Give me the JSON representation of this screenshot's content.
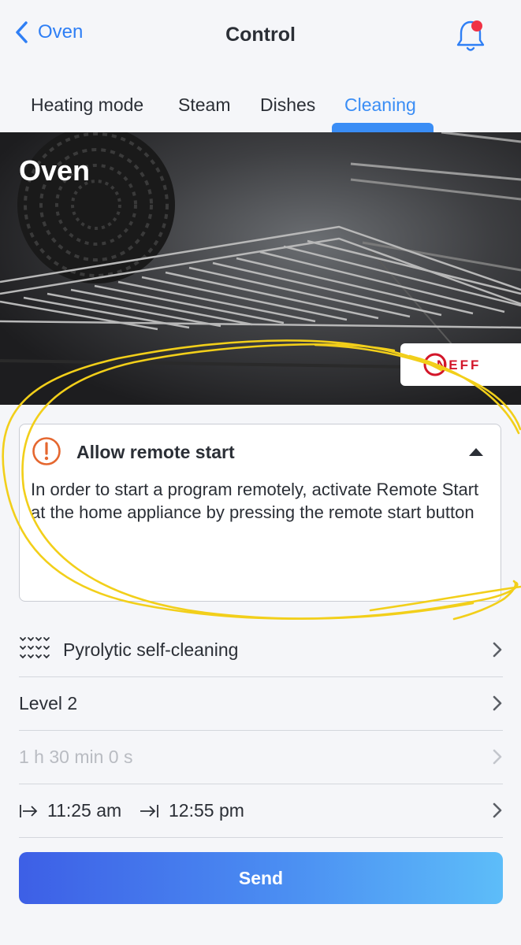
{
  "header": {
    "back_label": "Oven",
    "title": "Control"
  },
  "tabs": [
    {
      "label": "Heating mode",
      "active": false
    },
    {
      "label": "Steam",
      "active": false
    },
    {
      "label": "Dishes",
      "active": false
    },
    {
      "label": "Cleaning",
      "active": true
    }
  ],
  "hero": {
    "title": "Oven",
    "brand_logo": "NEFF"
  },
  "notice": {
    "title": "Allow remote start",
    "body": "In order to start a program remotely, activate Remote Start at the home appliance by pressing the remote start button",
    "icon": "warning-circle-icon",
    "expanded": true
  },
  "rows": {
    "program": "Pyrolytic self-cleaning",
    "level": "Level 2",
    "duration": "1 h 30 min 0 s",
    "start_time": "11:25 am",
    "end_time": "12:55 pm"
  },
  "send_label": "Send",
  "colors": {
    "accent": "#3a8df5",
    "warning": "#e5672f",
    "notification_dot": "#f03245",
    "annotation": "#f2cf1a"
  }
}
